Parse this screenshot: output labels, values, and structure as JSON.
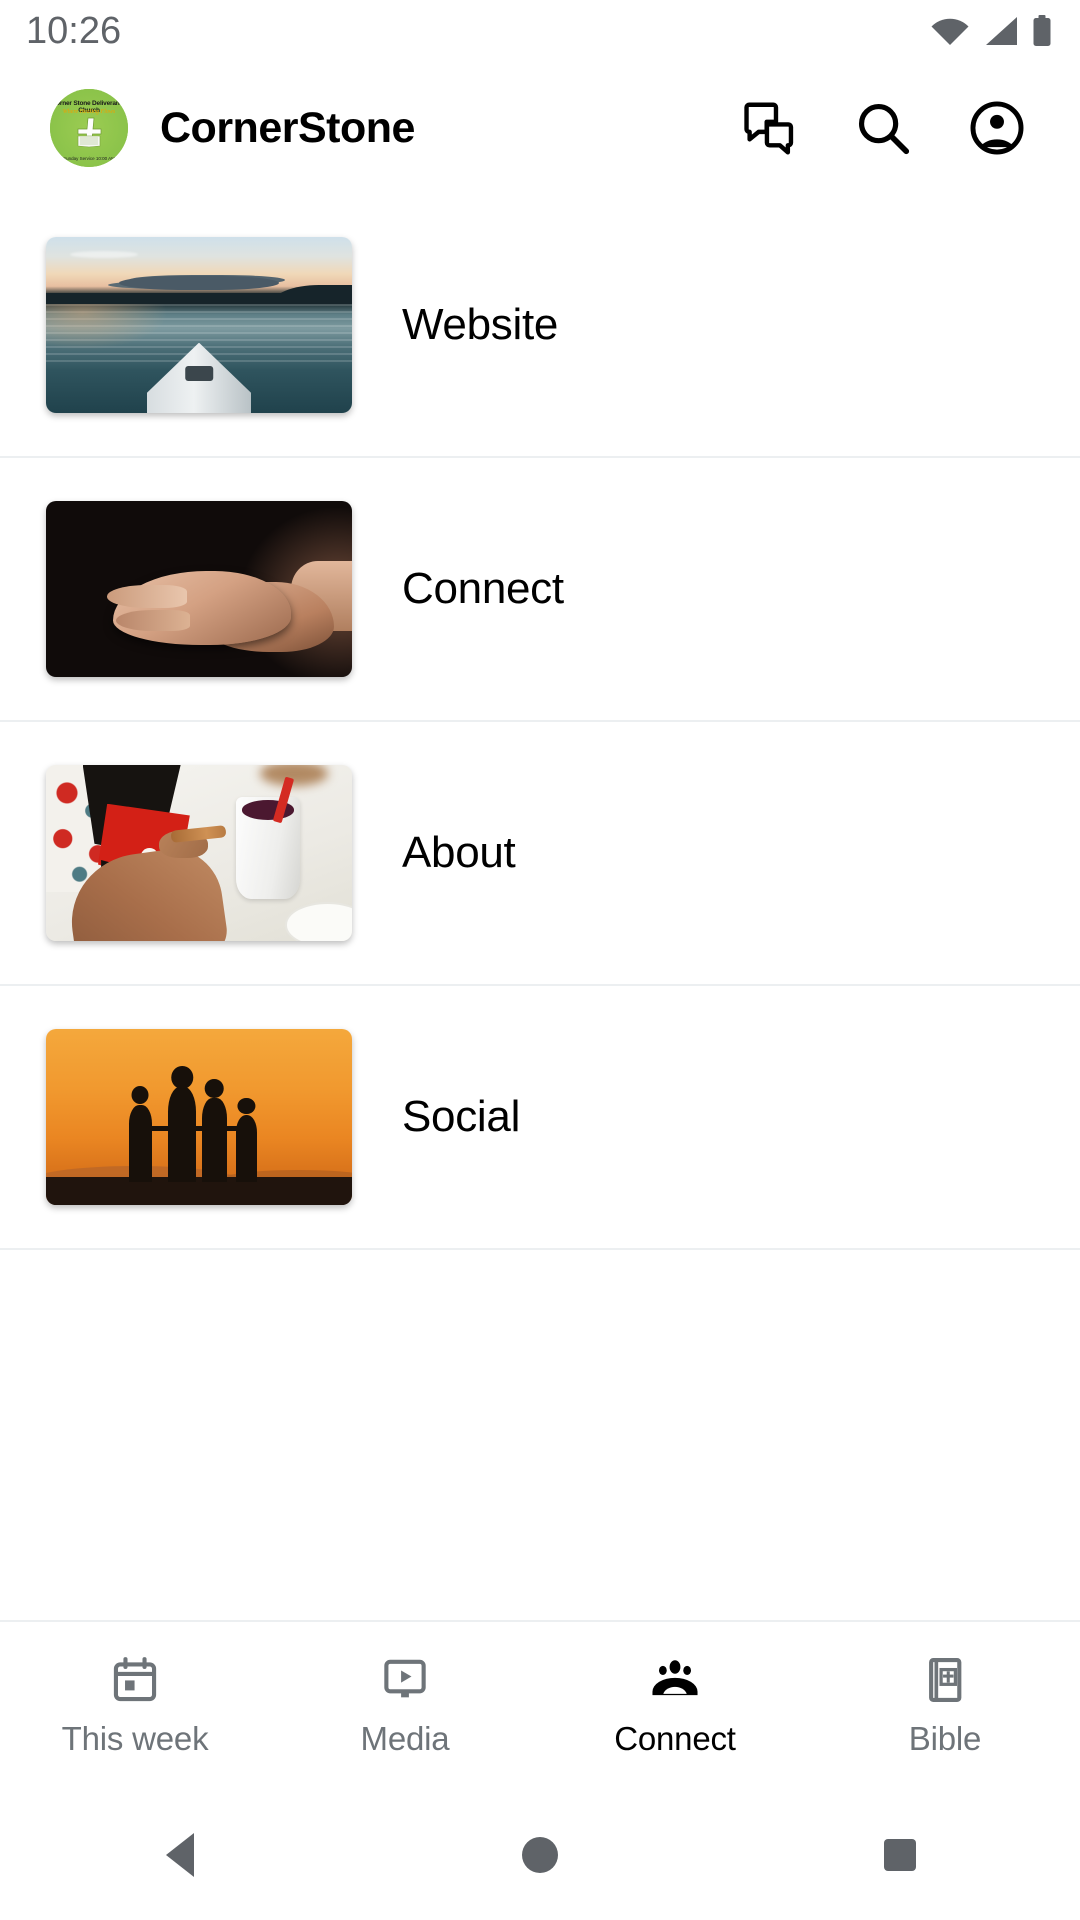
{
  "status_bar": {
    "time": "10:26",
    "icons": [
      "wifi-icon",
      "cellular-signal-icon",
      "battery-icon"
    ],
    "icon_color": "#5f6368"
  },
  "app_bar": {
    "logo": {
      "icon_name": "cornerstone-church-logo",
      "background_color": "#8bc34a",
      "top_text": "Corner Stone Deliverance Church",
      "sub_text": "Where Healing Flows",
      "bottom_text": "Sunday Service 10:00 AM"
    },
    "title": "CornerStone",
    "actions": [
      {
        "icon_name": "forum-chat-icon",
        "label": "Chat"
      },
      {
        "icon_name": "search-icon",
        "label": "Search"
      },
      {
        "icon_name": "account-circle-icon",
        "label": "Account"
      }
    ]
  },
  "list": {
    "items": [
      {
        "label": "Website",
        "thumbnail": "kayak-sunset-water-photo"
      },
      {
        "label": "Connect",
        "thumbnail": "open-hands-dark-photo"
      },
      {
        "label": "About",
        "thumbnail": "hand-biscuit-coffee-cup-photo"
      },
      {
        "label": "Social",
        "thumbnail": "family-silhouette-sunset-photo"
      }
    ]
  },
  "bottom_nav": {
    "active_index": 2,
    "active_color": "#000000",
    "inactive_color": "#6e7479",
    "items": [
      {
        "label": "This week",
        "icon_name": "calendar-icon"
      },
      {
        "label": "Media",
        "icon_name": "tv-play-icon"
      },
      {
        "label": "Connect",
        "icon_name": "people-group-icon"
      },
      {
        "label": "Bible",
        "icon_name": "bible-book-icon"
      }
    ]
  },
  "system_nav": {
    "buttons": [
      {
        "icon_name": "back-triangle-icon",
        "label": "Back"
      },
      {
        "icon_name": "home-circle-icon",
        "label": "Home"
      },
      {
        "icon_name": "recents-square-icon",
        "label": "Recents"
      }
    ]
  }
}
